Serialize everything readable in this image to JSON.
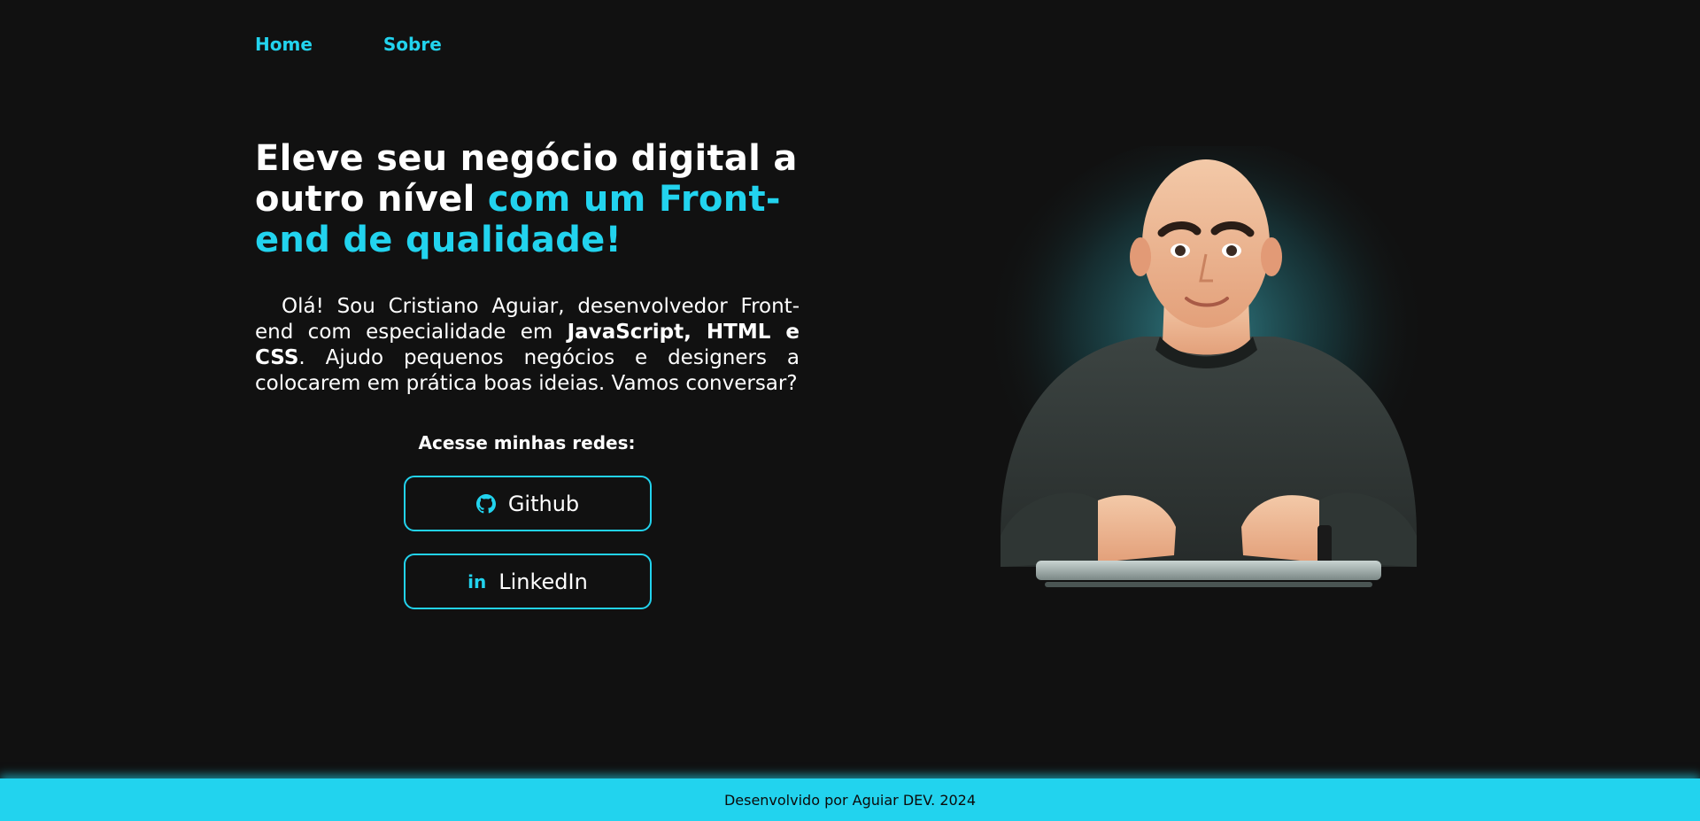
{
  "nav": {
    "items": [
      {
        "label": "Home"
      },
      {
        "label": "Sobre"
      }
    ]
  },
  "hero": {
    "headline_part1": "Eleve seu negócio digital a outro nível",
    "headline_part2": "com um Front-end de qualidade!",
    "intro_start": "Olá! Sou Cristiano Aguiar, desenvolvedor Front-end com especialidade em ",
    "intro_bold": "JavaScript, HTML e CSS",
    "intro_end": ". Ajudo pequenos negócios e designers a colocarem em prática boas ideias. Vamos conversar?"
  },
  "social": {
    "title": "Acesse minhas redes:",
    "github_label": "Github",
    "linkedin_label": "LinkedIn",
    "linkedin_glyph": "in"
  },
  "footer": {
    "text": "Desenvolvido por Aguiar DEV. 2024"
  },
  "colors": {
    "background": "#111111",
    "accent": "#22d3ee",
    "text": "#ffffff"
  },
  "icons": {
    "github": "github-icon",
    "linkedin": "linkedin-icon"
  }
}
